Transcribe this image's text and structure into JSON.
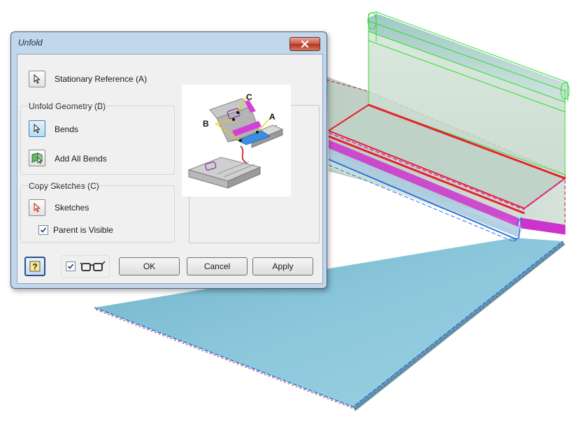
{
  "dialog": {
    "title": "Unfold",
    "stationary_label": "Stationary Reference (A)",
    "unfold_group_label": "Unfold Geometry (B)",
    "bends_label": "Bends",
    "add_all_bends_label": "Add All Bends",
    "copy_group_label": "Copy Sketches (C)",
    "sketches_label": "Sketches",
    "parent_visible_label": "Parent is Visible",
    "parent_visible_checked": true,
    "preview_checked": true,
    "ok_label": "OK",
    "cancel_label": "Cancel",
    "apply_label": "Apply"
  },
  "illustration": {
    "labels": [
      "A",
      "B",
      "C"
    ]
  },
  "colors": {
    "sheet_face": "#87c3d8",
    "bend_highlight": "#cc33cc",
    "selection_red": "#e8202a",
    "preview_green": "#33dd33",
    "edge_blue": "#2f6fe0"
  }
}
